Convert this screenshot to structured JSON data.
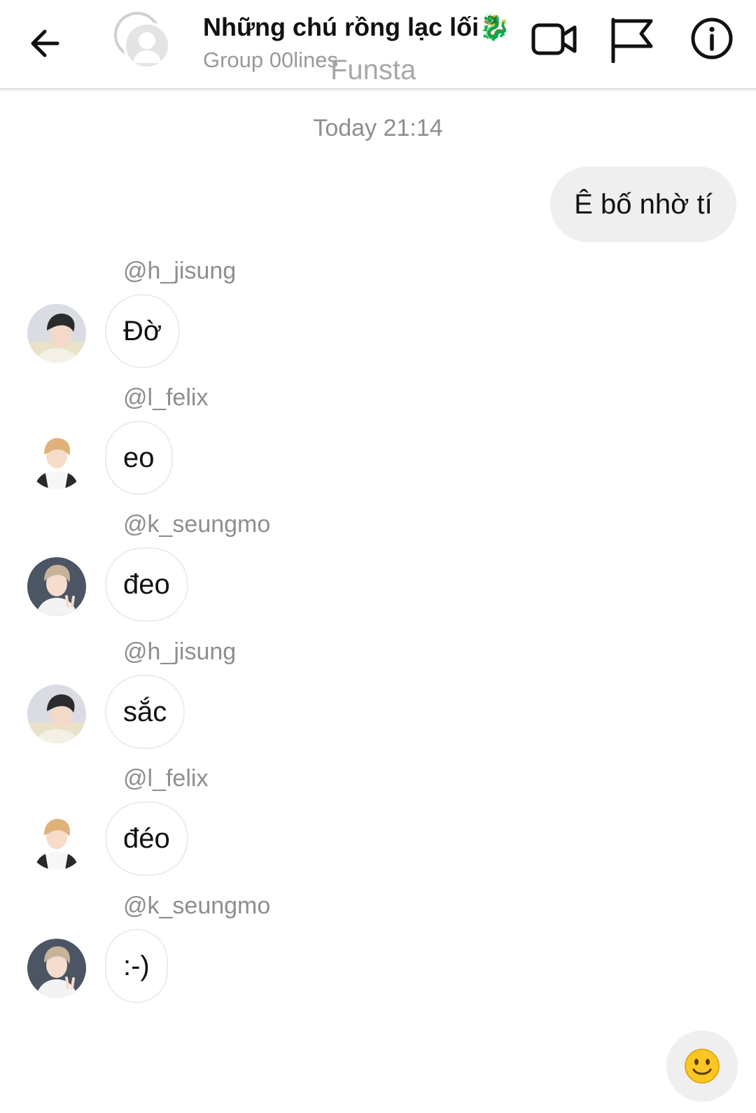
{
  "header": {
    "title": "Những chú rồng lạc lối🐉",
    "subtitle": "Group 00lines",
    "watermark": "Funsta",
    "icons": [
      "back-arrow-icon",
      "group-avatar-icon",
      "video-call-icon",
      "flag-icon",
      "info-icon"
    ]
  },
  "chat": {
    "timestamp": "Today 21:14",
    "outgoing": {
      "text": "Ê bố nhờ tí"
    },
    "messages": [
      {
        "sender": "@h_jisung",
        "text": "Đờ",
        "avatar": "avatar-jisung"
      },
      {
        "sender": "@l_felix",
        "text": "eo",
        "avatar": "avatar-felix"
      },
      {
        "sender": "@k_seungmo",
        "text": "đeo",
        "avatar": "avatar-seungmo"
      },
      {
        "sender": "@h_jisung",
        "text": "sắc",
        "avatar": "avatar-jisung"
      },
      {
        "sender": "@l_felix",
        "text": "đéo",
        "avatar": "avatar-felix"
      },
      {
        "sender": "@k_seungmo",
        "text": ":-)",
        "avatar": "avatar-seungmo"
      }
    ]
  },
  "composer": {
    "icon": "smiley-emoji-icon"
  }
}
